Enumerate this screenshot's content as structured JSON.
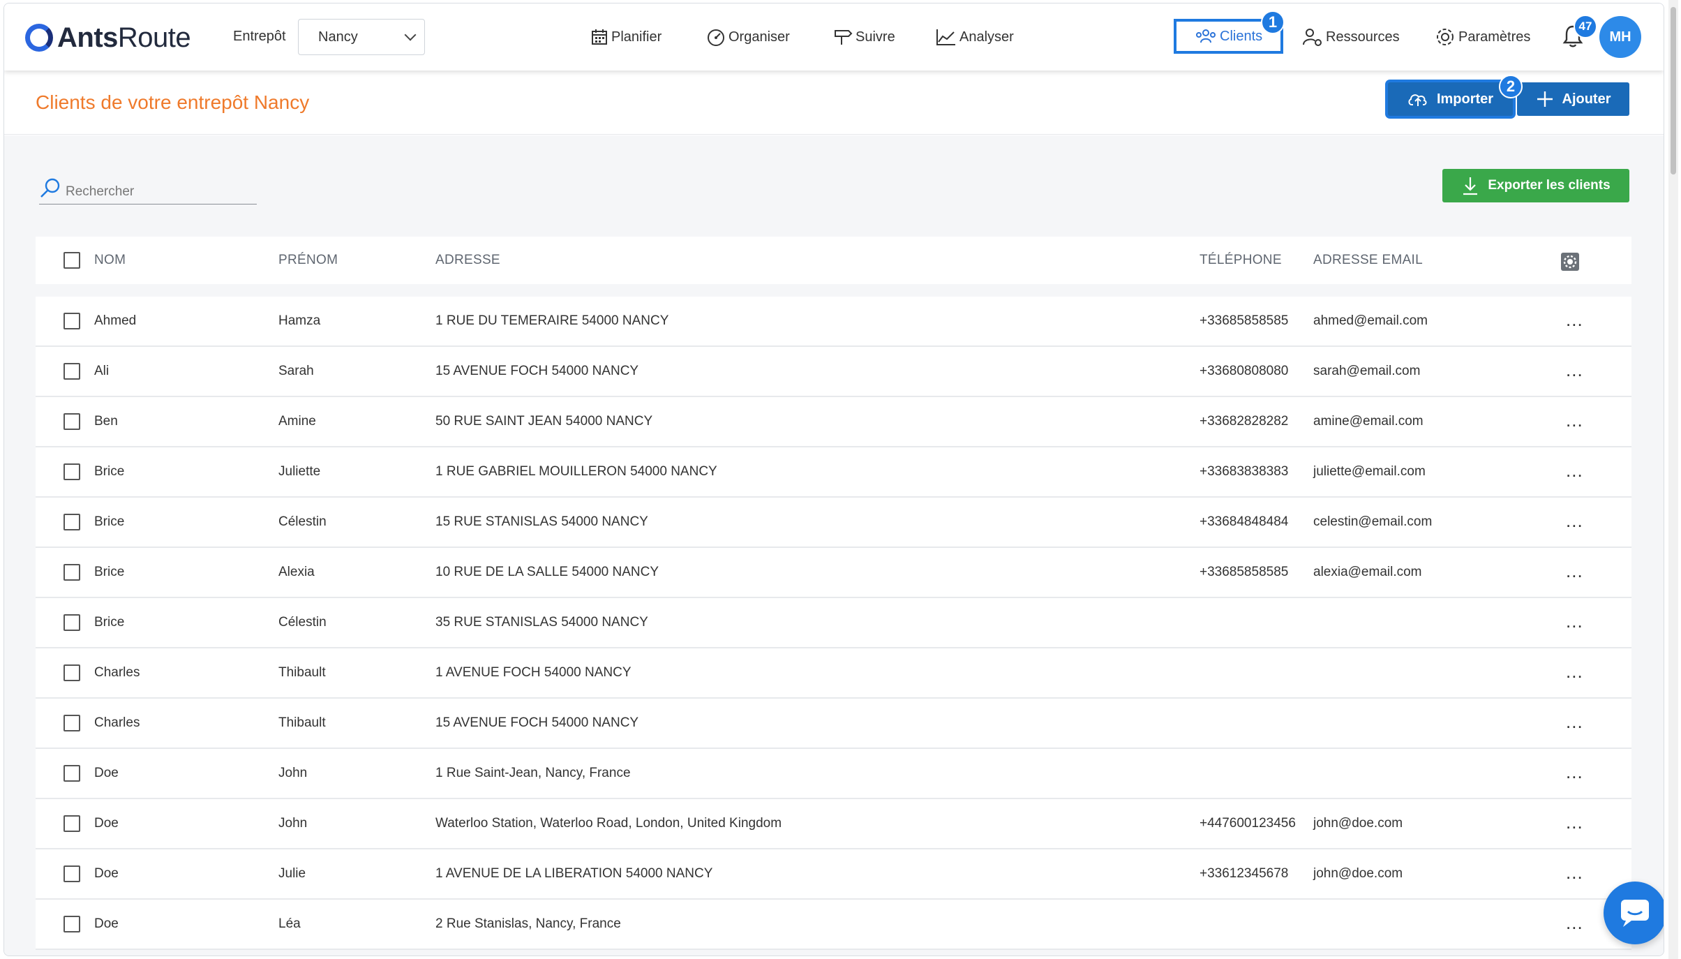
{
  "app": {
    "logo_bold": "Ants",
    "logo_light": "Route"
  },
  "warehouse": {
    "label": "Entrepôt",
    "selected": "Nancy"
  },
  "nav": {
    "planifier": "Planifier",
    "organiser": "Organiser",
    "suivre": "Suivre",
    "analyser": "Analyser",
    "clients": "Clients",
    "ressources": "Ressources",
    "parametres": "Paramètres"
  },
  "steps": {
    "one": "1",
    "two": "2"
  },
  "notifications": {
    "count": "47"
  },
  "user": {
    "initials": "MH"
  },
  "page": {
    "title": "Clients de votre entrepôt Nancy"
  },
  "actions": {
    "import": "Importer",
    "add": "Ajouter",
    "export": "Exporter les clients"
  },
  "search": {
    "placeholder": "Rechercher"
  },
  "table": {
    "headers": {
      "nom": "NOM",
      "prenom": "PRÉNOM",
      "adresse": "ADRESSE",
      "telephone": "TÉLÉPHONE",
      "email": "ADRESSE EMAIL"
    },
    "rows": [
      {
        "nom": "Ahmed",
        "prenom": "Hamza",
        "adresse": "1 RUE DU TEMERAIRE 54000 NANCY",
        "telephone": "+33685858585",
        "email": "ahmed@email.com"
      },
      {
        "nom": "Ali",
        "prenom": "Sarah",
        "adresse": "15 AVENUE FOCH 54000 NANCY",
        "telephone": "+33680808080",
        "email": "sarah@email.com"
      },
      {
        "nom": "Ben",
        "prenom": "Amine",
        "adresse": "50 RUE SAINT JEAN 54000 NANCY",
        "telephone": "+33682828282",
        "email": "amine@email.com"
      },
      {
        "nom": "Brice",
        "prenom": "Juliette",
        "adresse": "1 RUE GABRIEL MOUILLERON 54000 NANCY",
        "telephone": "+33683838383",
        "email": "juliette@email.com"
      },
      {
        "nom": "Brice",
        "prenom": "Célestin",
        "adresse": "15 RUE STANISLAS 54000 NANCY",
        "telephone": "+33684848484",
        "email": "celestin@email.com"
      },
      {
        "nom": "Brice",
        "prenom": "Alexia",
        "adresse": "10 RUE DE LA SALLE 54000 NANCY",
        "telephone": "+33685858585",
        "email": "alexia@email.com"
      },
      {
        "nom": "Brice",
        "prenom": "Célestin",
        "adresse": "35 RUE STANISLAS 54000 NANCY",
        "telephone": "",
        "email": ""
      },
      {
        "nom": "Charles",
        "prenom": "Thibault",
        "adresse": "1 AVENUE FOCH 54000 NANCY",
        "telephone": "",
        "email": ""
      },
      {
        "nom": "Charles",
        "prenom": "Thibault",
        "adresse": "15 AVENUE FOCH 54000 NANCY",
        "telephone": "",
        "email": ""
      },
      {
        "nom": "Doe",
        "prenom": "John",
        "adresse": "1 Rue Saint-Jean, Nancy, France",
        "telephone": "",
        "email": ""
      },
      {
        "nom": "Doe",
        "prenom": "John",
        "adresse": "Waterloo Station, Waterloo Road, London, United Kingdom",
        "telephone": "+447600123456",
        "email": "john@doe.com"
      },
      {
        "nom": "Doe",
        "prenom": "Julie",
        "adresse": "1 AVENUE DE LA LIBERATION 54000 NANCY",
        "telephone": "+33612345678",
        "email": "john@doe.com"
      },
      {
        "nom": "Doe",
        "prenom": "Léa",
        "adresse": "2 Rue Stanislas, Nancy, France",
        "telephone": "",
        "email": ""
      }
    ],
    "row_menu": "..."
  },
  "colors": {
    "accent": "#1f7ae0",
    "primary_button": "#1a6ab8",
    "export_button": "#3aa84a",
    "title": "#ef7a2b"
  }
}
